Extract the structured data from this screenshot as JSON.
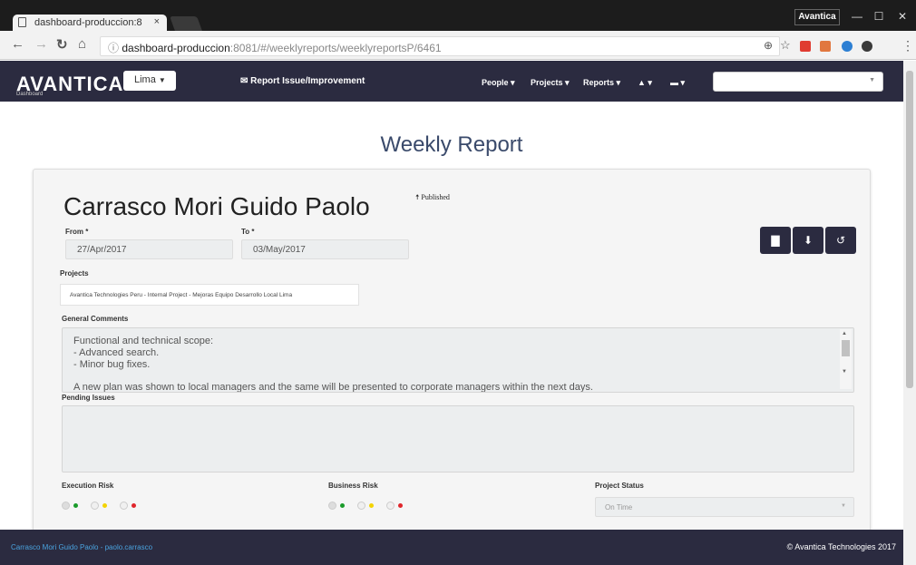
{
  "browser": {
    "tab_title": "dashboard-produccion:8",
    "tab_close": "×",
    "profile": "Avantica",
    "url_host": "dashboard-produccion",
    "url_rest": ":8081/#/weeklyreports/weeklyreportsP/6461",
    "icons": [
      "back-icon",
      "forward-icon",
      "reload-icon",
      "home-icon",
      "info-icon",
      "zoom-icon",
      "star-icon"
    ]
  },
  "nav": {
    "logo": "AVANTICA",
    "logo_sub": "Dashboard",
    "city": "Lima",
    "report_link": "✉ Report Issue/Improvement",
    "items": [
      "People ▾",
      "Projects ▾",
      "Reports ▾",
      "▲ ▾",
      "▬ ▾"
    ]
  },
  "page": {
    "title": "Weekly Report"
  },
  "report": {
    "name": "Carrasco Mori Guido Paolo",
    "status": "🠅 Published",
    "from_label": "From *",
    "from_value": "27/Apr/2017",
    "to_label": "To *",
    "to_value": "03/May/2017",
    "projects_label": "Projects",
    "project": "Avantica Technologies Peru - Internal Project - Mejoras Equipo Desarrollo Local Lima",
    "comments_label": "General Comments",
    "comments": [
      "Functional and technical scope:",
      "- Advanced search.",
      "- Minor bug fixes.",
      "",
      "A new plan was shown to local managers and the same will be presented to corporate managers within the next days."
    ],
    "pending_label": "Pending Issues",
    "exec_risk_label": "Execution Risk",
    "business_risk_label": "Business Risk",
    "project_status_label": "Project Status",
    "project_status_value": "On Time",
    "risk_colors": [
      "#1a9b2a",
      "#f3d300",
      "#e0262b"
    ]
  },
  "footer": {
    "user": "Carrasco Mori Guido Paolo - paolo.carrasco",
    "copyright": "© Avantica Technologies 2017"
  }
}
